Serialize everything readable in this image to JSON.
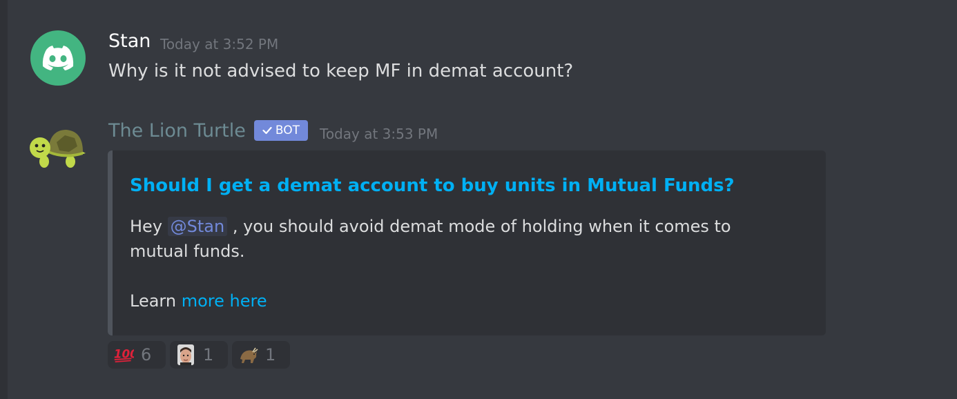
{
  "messages": [
    {
      "username": "Stan",
      "username_color": "#ffffff",
      "timestamp": "Today at 3:52 PM",
      "text": "Why is it not advised to keep MF in demat account?",
      "avatar": "discord-logo-icon"
    },
    {
      "username": "The Lion Turtle",
      "username_color": "#6d8b93",
      "bot_tag": "BOT",
      "timestamp": "Today at 3:53 PM",
      "avatar": "turtle-icon",
      "embed": {
        "title": "Should I get a demat account to buy units in Mutual Funds?",
        "desc_before": "Hey ",
        "mention": "@Stan",
        "desc_after": " , you should avoid demat mode of holding when it comes to mutual funds.",
        "learn_prefix": "Learn ",
        "learn_link": "more here"
      },
      "reactions": [
        {
          "emoji": "hundred-points-icon",
          "count": "6"
        },
        {
          "emoji": "face-emoji-icon",
          "count": "1"
        },
        {
          "emoji": "bull-emoji-icon",
          "count": "1"
        }
      ]
    }
  ],
  "colors": {
    "background": "#36393f",
    "embed_bg": "#2f3136",
    "link": "#00b0f4",
    "bot_tag": "#7289da",
    "discord_green": "#43b581"
  }
}
